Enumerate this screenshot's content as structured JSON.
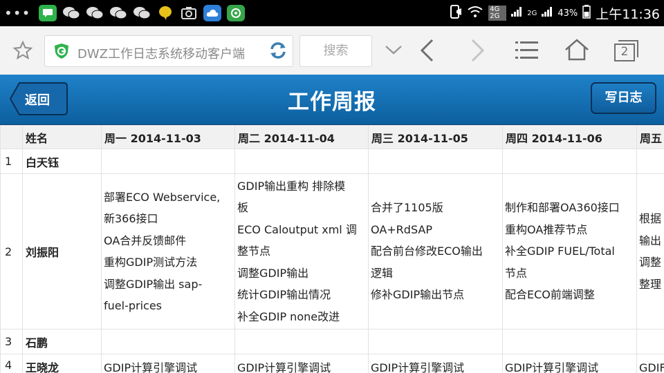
{
  "status_bar": {
    "network": "4G 2G",
    "network2": "2G",
    "battery": "43%",
    "time": "上午11:36"
  },
  "browser": {
    "url_text": "DWZ工作日志系统移动客户端",
    "search_label": "搜索",
    "tab_count": "2"
  },
  "header": {
    "back_label": "返回",
    "title": "工作周报",
    "write_label": "写日志",
    "color": "#1670b4"
  },
  "table": {
    "columns": [
      "",
      "姓名",
      "周一 2014-11-03",
      "周二 2014-11-04",
      "周三 2014-11-05",
      "周四 2014-11-06",
      "周五"
    ],
    "rows": [
      {
        "num": "1",
        "name": "白天钰",
        "days": [
          [],
          [],
          [],
          [],
          []
        ]
      },
      {
        "num": "2",
        "name": "刘振阳",
        "days": [
          [
            "部署ECO Webservice,",
            "新366接口",
            "OA合并反馈邮件",
            "重构GDIP测试方法",
            "调整GDIP输出 sap-",
            "fuel-prices"
          ],
          [
            "GDIP输出重构 排除模",
            "板",
            "ECO Caloutput xml 调",
            "整节点",
            "调整GDIP输出",
            "统计GDIP输出情况",
            "补全GDIP none改进"
          ],
          [
            "合并了1105版",
            "OA+RdSAP",
            "配合前台修改ECO输出",
            "逻辑",
            "修补GDIP输出节点"
          ],
          [
            "制作和部署OA360接口",
            "重构OA推荐节点",
            "补全GDIP FUEL/Total",
            "节点",
            "配合ECO前端调整"
          ],
          [
            "根据",
            "输出",
            "调整",
            "整理"
          ]
        ]
      },
      {
        "num": "3",
        "name": "石鹏",
        "days": [
          [],
          [],
          [],
          [],
          []
        ]
      },
      {
        "num": "4",
        "name": "王晓龙",
        "days": [
          [
            "GDIP计算引擎调试"
          ],
          [
            "GDIP计算引擎调试"
          ],
          [
            "GDIP计算引擎调试"
          ],
          [
            "GDIP计算引擎调试"
          ],
          [
            "GDIF"
          ]
        ]
      }
    ]
  }
}
